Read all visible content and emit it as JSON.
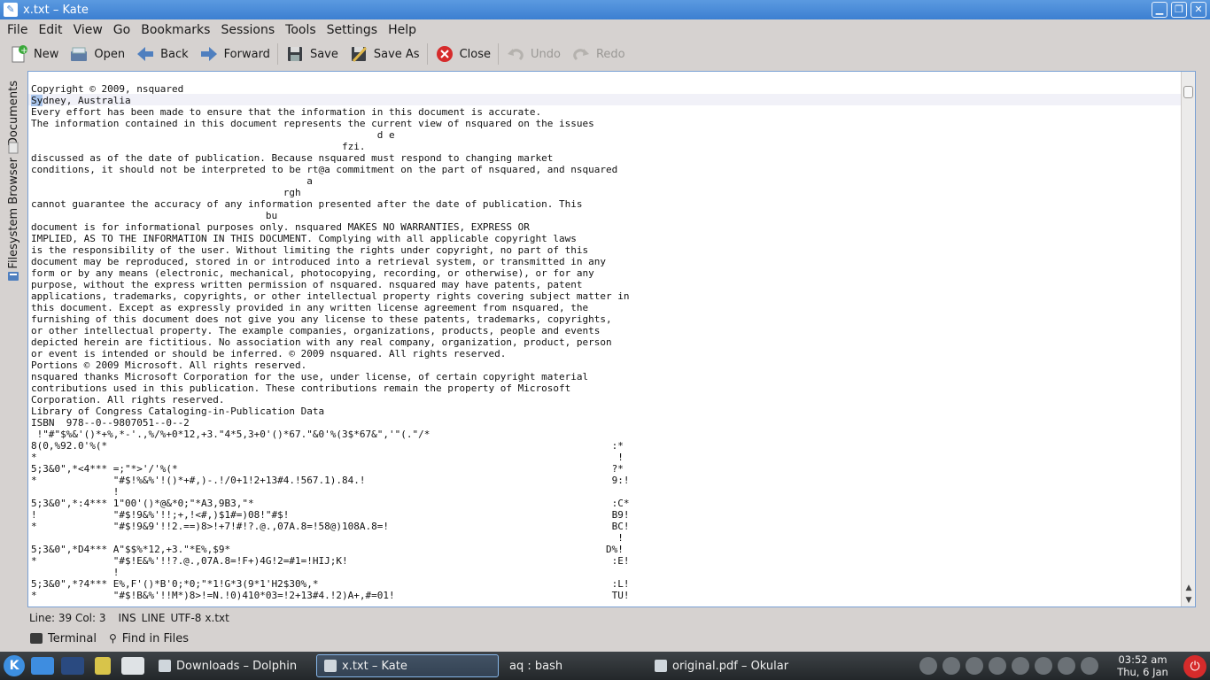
{
  "window": {
    "title": "x.txt – Kate"
  },
  "menu": [
    "File",
    "Edit",
    "View",
    "Go",
    "Bookmarks",
    "Sessions",
    "Tools",
    "Settings",
    "Help"
  ],
  "toolbar": {
    "new": "New",
    "open": "Open",
    "back": "Back",
    "forward": "Forward",
    "save": "Save",
    "save_as": "Save As",
    "close": "Close",
    "undo": "Undo",
    "redo": "Redo"
  },
  "sidebar": {
    "documents": "Documents",
    "filesystem": "Filesystem Browser"
  },
  "editor": {
    "line1": "Copyright © 2009, nsquared",
    "line2_sel": "Sy",
    "line2_rest": "dney, Australia",
    "body": "Every effort has been made to ensure that the information in this document is accurate.\nThe information contained in this document represents the current view of nsquared on the issues\n                                                           d e\n                                                     fzi.\ndiscussed as of the date of publication. Because nsquared must respond to changing market\nconditions, it should not be interpreted to be rt@a commitment on the part of nsquared, and nsquared\n                                               a\n                                           rgh\ncannot guarantee the accuracy of any information presented after the date of publication. This\n                                        bu\ndocument is for informational purposes only. nsquared MAKES NO WARRANTIES, EXPRESS OR\nIMPLIED, AS TO THE INFORMATION IN THIS DOCUMENT. Complying with all applicable copyright laws\nis the responsibility of the user. Without limiting the rights under copyright, no part of this\ndocument may be reproduced, stored in or introduced into a retrieval system, or transmitted in any\nform or by any means (electronic, mechanical, photocopying, recording, or otherwise), or for any\npurpose, without the express written permission of nsquared. nsquared may have patents, patent\napplications, trademarks, copyrights, or other intellectual property rights covering subject matter in\nthis document. Except as expressly provided in any written license agreement from nsquared, the\nfurnishing of this document does not give you any license to these patents, trademarks, copyrights,\nor other intellectual property. The example companies, organizations, products, people and events\ndepicted herein are fictitious. No association with any real company, organization, product, person\nor event is intended or should be inferred. © 2009 nsquared. All rights reserved.\nPortions © 2009 Microsoft. All rights reserved.\nnsquared thanks Microsoft Corporation for the use, under license, of certain copyright material\ncontributions used in this publication. These contributions remain the property of Microsoft\nCorporation. All rights reserved.\nLibrary of Congress Cataloging-in-Publication Data\nISBN  978--0--9807051--0--2\n !\"#\"$%&'()*+%,*-'.,%/%+0*12,+3.\"4*5,3+0'()*67.\"&0'%(3$*67&\",'\"(.\"/*\n8(0,%92.0'%(*                                                                                      :*\n*                                                                                                   !\n5;3&0\",*<4*** =;\"*>'/'%(*                                                                          ?*\n*             \"#$!%&%'!()*+#,)-.!/0+1!2+13#4.!567.1).84.!                                          9:!\n              !\n5;3&0\",*:4*** 1\"00'()*@&*0;\"*A3,9B3,\"*                                                             :C*\n!             \"#$!9&%'!!;+,!<#,)$1#=)08!\"#$!                                                       B9!\n*             \"#$!9&9'!!2.==)8>!+7!#!?.@.,07A.8=!58@)108A.8=!                                      BC!\n                                                                                                    !\n5;3&0\",*D4*** A\"$$%*12,+3.\"*E%,$9*                                                                D%!\n*             \"#$!E&%'!!?.@.,07A.8=!F+)4G!2=#1=!HIJ;K!                                             :E!\n              !\n5;3&0\",*?4*** E%,F'()*B'0;*0;\"*1!G*3(9*1'H2$30%,*                                                  :L!\n*             \"#$!B&%'!!M*)8>!=N.!0)410*03=!2+13#4.!2)A+,#=01!                                     TU!"
  },
  "status": {
    "position": "Line: 39 Col: 3",
    "mode": "INS",
    "selection": "LINE",
    "encoding": "UTF-8",
    "filename": "x.txt"
  },
  "toolviews": {
    "terminal": "Terminal",
    "find": "Find in Files"
  },
  "taskbar": {
    "tasks": [
      "Downloads – Dolphin",
      "x.txt – Kate",
      "aq : bash",
      "original.pdf – Okular"
    ],
    "time": "03:52 am",
    "date": "Thu, 6 Jan"
  },
  "colors": {
    "title_bar": "#4a8ddb",
    "panel": "#2b2f32",
    "selection": "#a9c5ec",
    "close_red": "#d62b2b"
  }
}
